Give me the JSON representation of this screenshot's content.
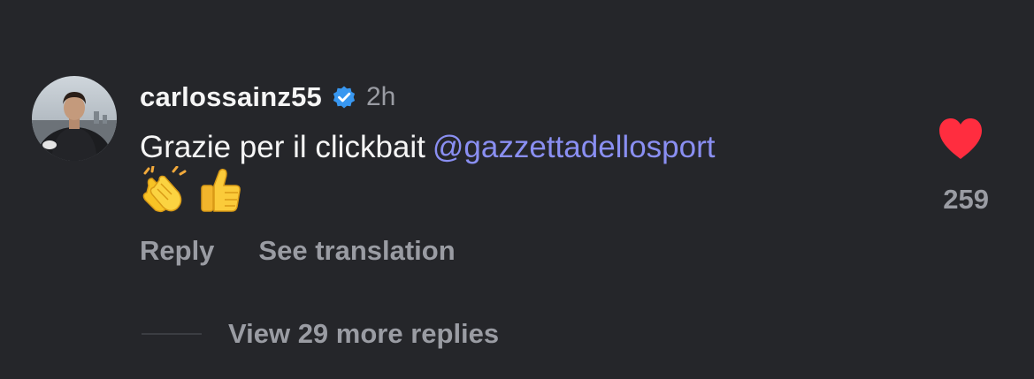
{
  "comment": {
    "username": "carlossainz55",
    "time": "2h",
    "text": "Grazie per il clickbait",
    "mention": "@gazzettadellosport",
    "emojis": [
      "clapping-hands-emoji",
      "thumbs-up-emoji"
    ],
    "like_count": "259",
    "liked": true
  },
  "actions": {
    "reply_label": "Reply",
    "translate_label": "See translation"
  },
  "replies": {
    "more_label": "View 29 more replies"
  },
  "icons": {
    "verified": "verified-badge-icon",
    "like": "heart-icon"
  },
  "colors": {
    "background": "#25262a",
    "mention": "#8a8ff2",
    "verified": "#3897f0",
    "heart": "#ff2d3f",
    "secondary_text": "#9a9ca3"
  }
}
